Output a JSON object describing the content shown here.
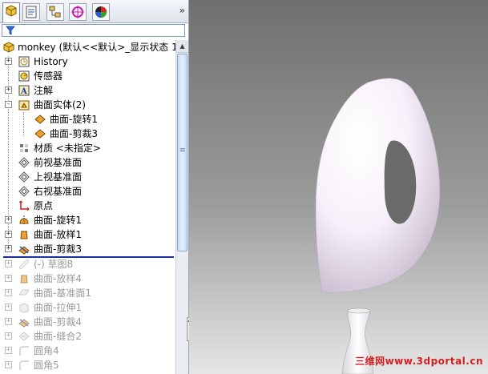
{
  "tabs": [
    {
      "icon": "feature-manager-icon",
      "active": true
    },
    {
      "icon": "property-manager-icon",
      "active": false
    },
    {
      "icon": "configuration-manager-icon",
      "active": false
    },
    {
      "icon": "dimxpert-icon",
      "active": false
    },
    {
      "icon": "display-manager-icon",
      "active": false
    }
  ],
  "more_tabs_glyph": "»",
  "filter_icon": "filter-icon",
  "root": {
    "label": "monkey  (默认<<默认>_显示状态 1"
  },
  "tree": [
    {
      "label": "History",
      "icon": "history-icon",
      "expander": "+"
    },
    {
      "label": "传感器",
      "icon": "sensor-icon",
      "expander": ""
    },
    {
      "label": "注解",
      "icon": "annotation-icon",
      "expander": "+"
    },
    {
      "label": "曲面实体(2)",
      "icon": "surface-bodies-folder-icon",
      "expander": "-"
    },
    {
      "label": "曲面-旋转1",
      "icon": "surface-body-icon",
      "expander": "",
      "indent": 1
    },
    {
      "label": "曲面-剪裁3",
      "icon": "surface-body-icon",
      "expander": "",
      "indent": 1
    },
    {
      "label": "材质 <未指定>",
      "icon": "material-icon",
      "expander": ""
    },
    {
      "label": "前视基准面",
      "icon": "plane-icon",
      "expander": ""
    },
    {
      "label": "上视基准面",
      "icon": "plane-icon",
      "expander": ""
    },
    {
      "label": "右视基准面",
      "icon": "plane-icon",
      "expander": ""
    },
    {
      "label": "原点",
      "icon": "origin-icon",
      "expander": ""
    },
    {
      "label": "曲面-旋转1",
      "icon": "surface-revolve-icon",
      "expander": "+"
    },
    {
      "label": "曲面-放样1",
      "icon": "surface-loft-icon",
      "expander": "+"
    },
    {
      "label": "曲面-剪裁3",
      "icon": "surface-trim-icon",
      "expander": "+"
    }
  ],
  "suppressed": [
    {
      "label": "(-) 草图8",
      "icon": "sketch-icon"
    },
    {
      "label": "曲面-放样4",
      "icon": "surface-loft-icon"
    },
    {
      "label": "曲面-基准面1",
      "icon": "planar-surface-icon"
    },
    {
      "label": "曲面-拉伸1",
      "icon": "surface-extrude-icon"
    },
    {
      "label": "曲面-剪裁4",
      "icon": "surface-trim-icon"
    },
    {
      "label": "曲面-缝合2",
      "icon": "surface-knit-icon"
    },
    {
      "label": "圆角4",
      "icon": "fillet-icon"
    },
    {
      "label": "圆角5",
      "icon": "fillet-icon"
    }
  ],
  "scroll_up_glyph": "▲",
  "scroll_grip_glyph": "≡",
  "collapse_glyph": "◂▸",
  "viewport": {
    "background_top": "#6f6f6f",
    "background_bottom": "#e6e6e6",
    "model_color": "#f7f0fa"
  },
  "watermark": "三维网www.3dportal.cn"
}
